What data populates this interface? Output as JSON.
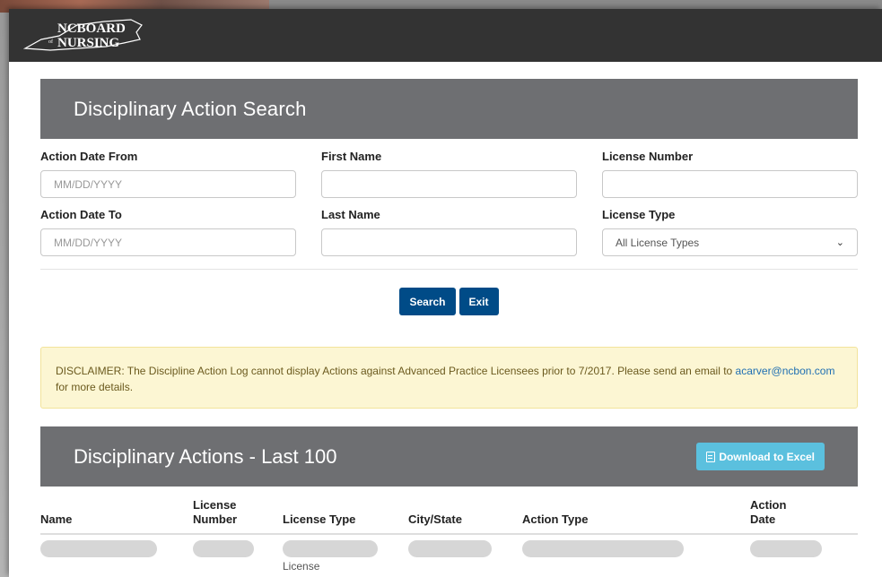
{
  "header": {
    "logo_line1": "NCBOARD",
    "logo_line2": "NURSING",
    "logo_of": "of"
  },
  "search_panel": {
    "title": "Disciplinary Action Search",
    "fields": {
      "action_date_from": {
        "label": "Action Date From",
        "placeholder": "MM/DD/YYYY",
        "value": ""
      },
      "first_name": {
        "label": "First Name",
        "placeholder": "",
        "value": ""
      },
      "license_number": {
        "label": "License Number",
        "placeholder": "",
        "value": ""
      },
      "action_date_to": {
        "label": "Action Date To",
        "placeholder": "MM/DD/YYYY",
        "value": ""
      },
      "last_name": {
        "label": "Last Name",
        "placeholder": "",
        "value": ""
      },
      "license_type": {
        "label": "License Type",
        "selected": "All License Types"
      }
    },
    "buttons": {
      "search": "Search",
      "exit": "Exit"
    }
  },
  "disclaimer": {
    "text": "DISCLAIMER: The Discipline Action Log cannot display Actions against Advanced Practice Licensees prior to 7/2017. Please send an email to ",
    "email": "acarver@ncbon.com",
    "suffix": " for more details."
  },
  "results_panel": {
    "title": "Disciplinary Actions - Last 100",
    "download_label": "Download to Excel"
  },
  "table": {
    "columns": {
      "name": "Name",
      "license_number": "License Number",
      "license_type": "License Type",
      "city_state": "City/State",
      "action_type": "Action Type",
      "action_date": "Action Date"
    },
    "row_sub_label": "License"
  },
  "colors": {
    "topbar": "#333333",
    "panel_header": "#6e6f72",
    "primary_button": "#004b87",
    "info_button": "#5bc0de",
    "disclaimer_bg": "#fcf6d3"
  }
}
